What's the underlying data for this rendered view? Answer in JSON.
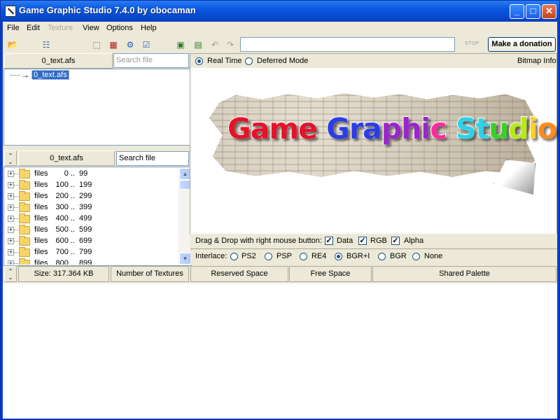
{
  "window": {
    "title": "Game Graphic Studio 7.4.0 by obocaman"
  },
  "title_buttons": {
    "minimize": "_",
    "maximize": "□",
    "close": "✕"
  },
  "menu": [
    {
      "label": "File",
      "enabled": true
    },
    {
      "label": "Edit",
      "enabled": true
    },
    {
      "label": "Texture",
      "enabled": false
    },
    {
      "label": "View",
      "enabled": true
    },
    {
      "label": "Options",
      "enabled": true
    },
    {
      "label": "Help",
      "enabled": true
    }
  ],
  "toolbar": {
    "address_value": "",
    "stop_label": "STOP",
    "donate_label": "Make a donation"
  },
  "top_panel": {
    "file_label": "0_text.afs",
    "search_placeholder": "Search file",
    "tree_root": "0_text.afs"
  },
  "lower_panel": {
    "file_label": "0_text.afs",
    "search_value": "Search file",
    "rows": [
      {
        "name": "files",
        "from": "0 ..",
        "to": "99"
      },
      {
        "name": "files",
        "from": "100 ..",
        "to": "199"
      },
      {
        "name": "files",
        "from": "200 ..",
        "to": "299"
      },
      {
        "name": "files",
        "from": "300 ..",
        "to": "399"
      },
      {
        "name": "files",
        "from": "400 ..",
        "to": "499"
      },
      {
        "name": "files",
        "from": "500 ..",
        "to": "599"
      },
      {
        "name": "files",
        "from": "600 ..",
        "to": "699"
      },
      {
        "name": "files",
        "from": "700 ..",
        "to": "799"
      },
      {
        "name": "files",
        "from": "800 ..",
        "to": "899"
      }
    ]
  },
  "mode": {
    "real_time": "Real Time",
    "deferred": "Deferred Mode",
    "selected": "real_time",
    "bitmap_info": "Bitmap Info"
  },
  "logo": {
    "text": "Game Graphic Studio",
    "colors": [
      "#e8112a",
      "#e8112a",
      "#e8112a",
      "#e8112a",
      "#ffffff",
      "#2a3ee6",
      "#2a3ee6",
      "#2a3ee6",
      "#9a26c9",
      "#9a26c9",
      "#9a26c9",
      "#ff2aa0",
      "#ffffff",
      "#2fd1e8",
      "#2fd1e8",
      "#3ccf2a",
      "#b7e81a",
      "#ffd21a",
      "#ff8c1a"
    ]
  },
  "dragdrop": {
    "label": "Drag & Drop with right mouse button:",
    "data": {
      "label": "Data",
      "checked": true
    },
    "rgb": {
      "label": "RGB",
      "checked": true
    },
    "alpha": {
      "label": "Alpha",
      "checked": true
    }
  },
  "interface": {
    "label": "Interlace:",
    "options": [
      "PS2",
      "PSP",
      "RE4",
      "BGR+I",
      "BGR",
      "None"
    ],
    "selected": "BGR+I"
  },
  "status": {
    "size": "Size: 317.364 KB",
    "textures": "Number of Textures",
    "reserved": "Reserved Space",
    "free": "Free Space",
    "palette": "Shared Palette"
  }
}
